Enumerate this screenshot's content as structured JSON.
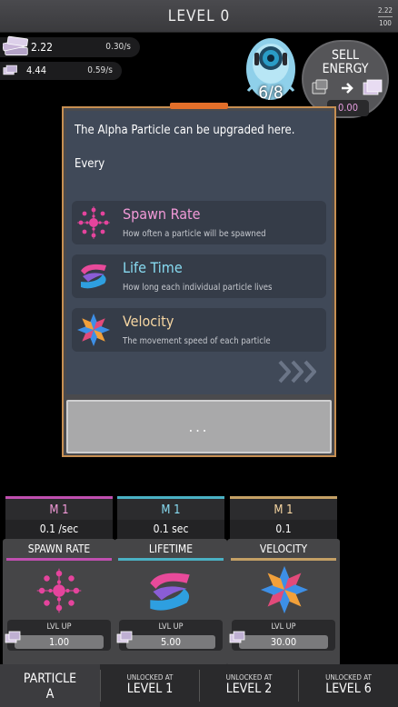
{
  "header": {
    "title": "LEVEL 0",
    "progress_current": "2.22",
    "progress_target": "100",
    "progress_fraction": 0.022
  },
  "currency": {
    "primary": {
      "amount": "2.22",
      "rate": "0.30/s",
      "icon": "cash-stack-icon"
    },
    "secondary": {
      "amount": "4.44",
      "rate": "0.59/s",
      "icon": "cash-bundle-icon"
    }
  },
  "robot": {
    "count": "6/8",
    "icon": "robot-icon"
  },
  "sell": {
    "label_line1": "SELL",
    "label_line2": "ENERGY",
    "price": "0.00"
  },
  "modal": {
    "message": "The Alpha Particle can be upgraded here.",
    "message2": "Every",
    "upgrades": [
      {
        "title": "Spawn Rate",
        "desc": "How often a particle will be spawned",
        "color": "#f29ad8",
        "icon": "spawn-rate-icon"
      },
      {
        "title": "Life Time",
        "desc": "How long each individual particle lives",
        "color": "#88dcf2",
        "icon": "life-time-icon"
      },
      {
        "title": "Velocity",
        "desc": "The movement speed of each particle",
        "color": "#f6d6a2",
        "icon": "velocity-icon"
      }
    ],
    "continue_label": "..."
  },
  "cards": [
    {
      "multiplier": "M 1",
      "value": "0.1 /sec",
      "label": "SPAWN RATE",
      "lvl_label": "LVL UP",
      "cost": "1.00",
      "color": "#c04fb0",
      "icon": "spawn-rate-icon"
    },
    {
      "multiplier": "M 1",
      "value": "0.1 sec",
      "label": "LIFETIME",
      "lvl_label": "LVL UP",
      "cost": "5.00",
      "color": "#4ab1c4",
      "icon": "life-time-icon"
    },
    {
      "multiplier": "M 1",
      "value": "0.1",
      "label": "VELOCITY",
      "lvl_label": "LVL UP",
      "cost": "30.00",
      "color": "#c4a065",
      "icon": "velocity-icon"
    }
  ],
  "bottom_tabs": [
    {
      "line1": "PARTICLE",
      "line2": "A",
      "active": true
    },
    {
      "small": "UNLOCKED AT",
      "big": "LEVEL 1"
    },
    {
      "small": "UNLOCKED AT",
      "big": "LEVEL 2"
    },
    {
      "small": "UNLOCKED AT",
      "big": "LEVEL 6"
    }
  ]
}
